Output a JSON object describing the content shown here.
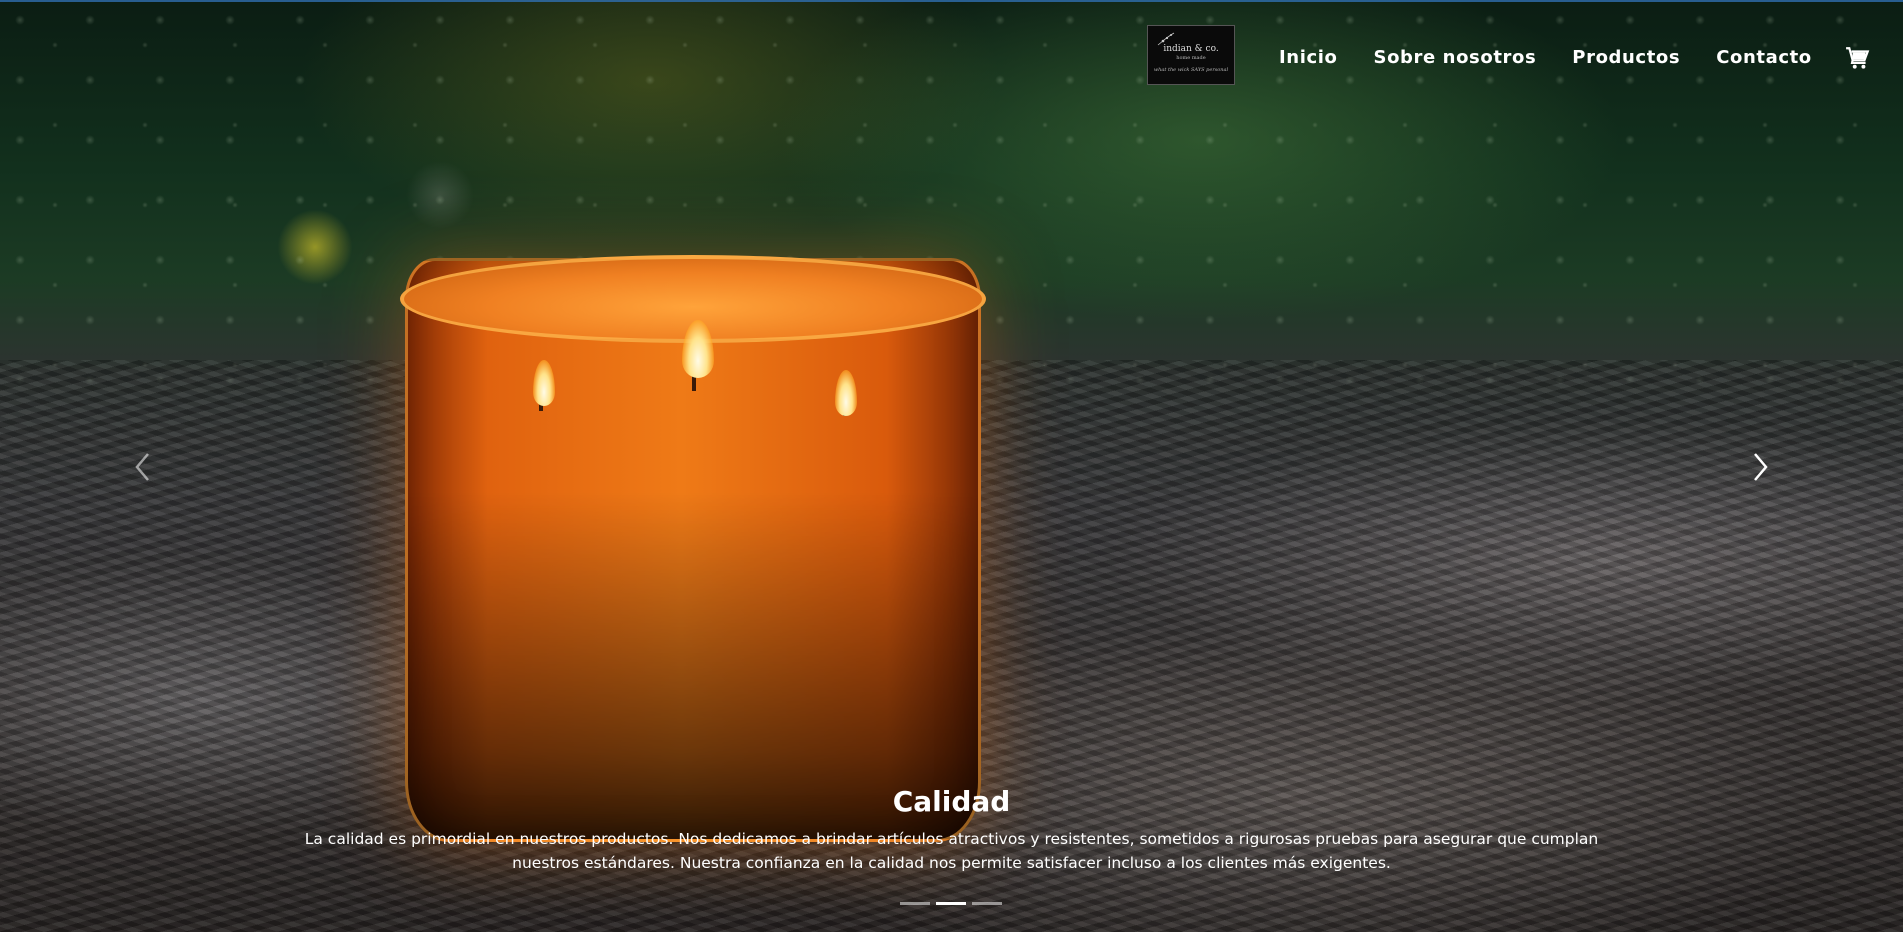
{
  "navbar": {
    "logo": {
      "name": "indian & co.",
      "subname": "home made",
      "tagline": "what the wick SAYS personal"
    },
    "links": [
      "Inicio",
      "Sobre nosotros",
      "Productos",
      "Contacto"
    ],
    "cart_icon": "cart-icon"
  },
  "carousel": {
    "prev_icon": "chevron-left-icon",
    "next_icon": "chevron-right-icon",
    "active_slide": 2,
    "slide_count": 3,
    "caption": {
      "title": "Calidad",
      "text": "La calidad es primordial en nuestros productos. Nos dedicamos a brindar artículos atractivos y resistentes, sometidos a rigurosas pruebas para asegurar que cumplan nuestros estándares. Nuestra confianza en la calidad nos permite satisfacer incluso a los clientes más exigentes."
    }
  },
  "colors": {
    "text": "#ffffff",
    "indicator_inactive": "#ffffff80",
    "candle": "#e96f14"
  }
}
